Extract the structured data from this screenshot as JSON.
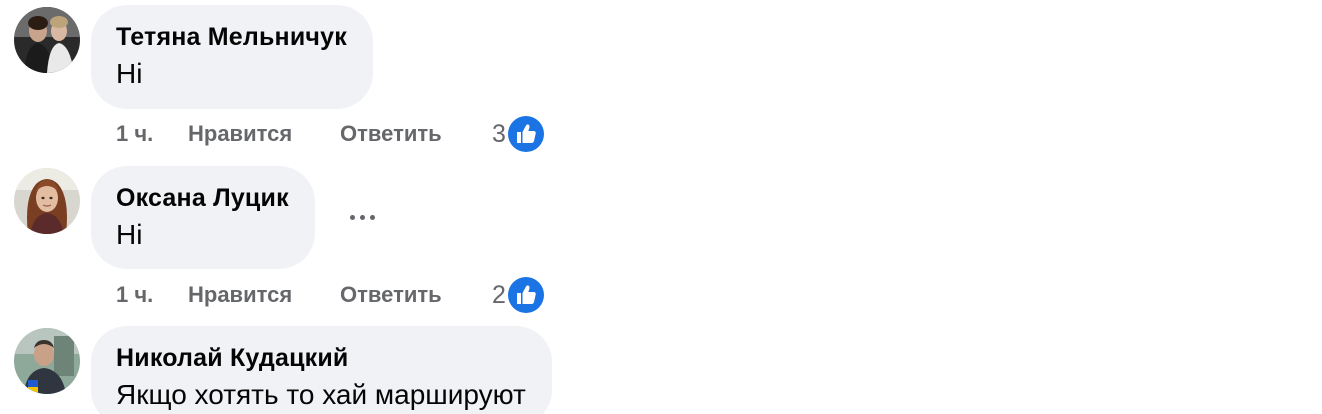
{
  "comments": [
    {
      "author": "Тетяна Мельничук",
      "text": "Ні",
      "time": "1 ч.",
      "like_label": "Нравится",
      "reply_label": "Ответить",
      "reaction_count": "3",
      "reaction_icon": "like-icon"
    },
    {
      "author": "Оксана Луцик",
      "text": "Ні",
      "time": "1 ч.",
      "like_label": "Нравится",
      "reply_label": "Ответить",
      "reaction_count": "2",
      "reaction_icon": "like-icon",
      "more_icon": "more-options-icon"
    },
    {
      "author": "Николай Кудацкий",
      "text": "Якщо хотять то хай маршируют"
    }
  ],
  "colors": {
    "bubble": "#f0f2f5",
    "text": "#050505",
    "secondary": "#65676b",
    "like_blue": "#1b74e4"
  }
}
